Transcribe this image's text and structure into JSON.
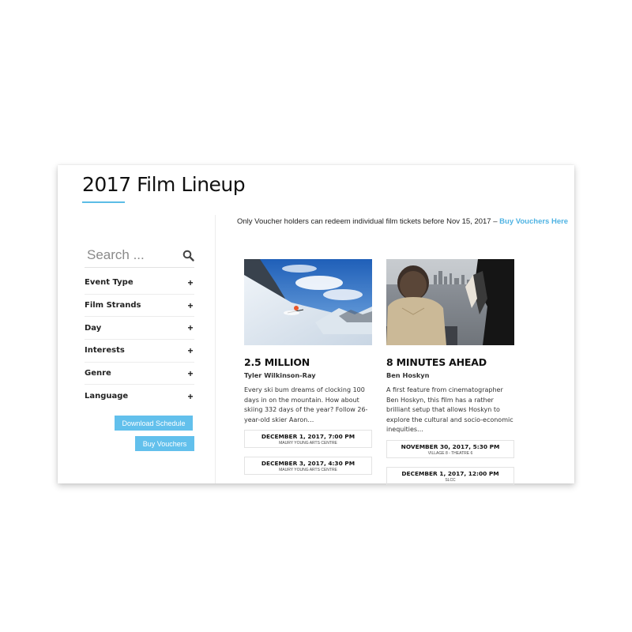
{
  "page": {
    "title": "2017 Film Lineup"
  },
  "search": {
    "placeholder": "Search ..."
  },
  "filters": [
    {
      "label": "Event Type"
    },
    {
      "label": "Film Strands"
    },
    {
      "label": "Day"
    },
    {
      "label": "Interests"
    },
    {
      "label": "Genre"
    },
    {
      "label": "Language"
    }
  ],
  "buttons": {
    "download_schedule": "Download Schedule",
    "buy_vouchers": "Buy Vouchers"
  },
  "notice": {
    "text": "Only Voucher holders can redeem individual film tickets before Nov 15, 2017 – ",
    "link": "Buy Vouchers Here"
  },
  "films": [
    {
      "title": "2.5 MILLION",
      "director": "Tyler Wilkinson-Ray",
      "description": "Every ski bum dreams of clocking 100 days in on the mountain. How about skiing 332 days of the year? Follow 26-year-old skier Aaron…",
      "showtimes": [
        {
          "date": "DECEMBER 1, 2017, 7:00 PM",
          "venue": "MAURY YOUNG ARTS CENTRE"
        },
        {
          "date": "DECEMBER 3, 2017, 4:30 PM",
          "venue": "MAURY YOUNG ARTS CENTRE"
        }
      ]
    },
    {
      "title": "8 MINUTES AHEAD",
      "director": "Ben Hoskyn",
      "description": "A first feature from cinematographer Ben Hoskyn, this film has a rather brilliant setup that allows Hoskyn to explore the cultural and socio-economic inequities…",
      "showtimes": [
        {
          "date": "NOVEMBER 30, 2017, 5:30 PM",
          "venue": "VILLAGE 8 - THEATRE 6"
        },
        {
          "date": "DECEMBER 1, 2017, 12:00 PM",
          "venue": "SLCC"
        }
      ]
    }
  ],
  "colors": {
    "accent": "#5bbde6",
    "button": "#62c0ec",
    "link": "#4fb3e3"
  },
  "icons": {
    "search": "search-icon",
    "expand": "plus-icon"
  }
}
